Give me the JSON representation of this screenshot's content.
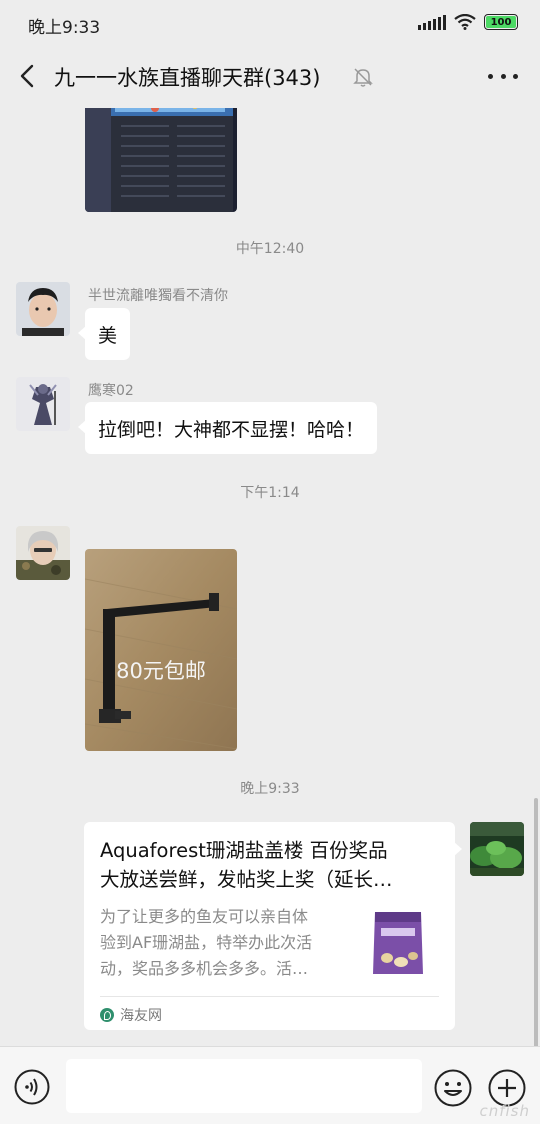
{
  "status_bar": {
    "time": "晚上9:33",
    "battery": "100"
  },
  "header": {
    "title": "九一一水族直播聊天群(343)"
  },
  "messages": {
    "timestamp_1": "中午12:40",
    "msg1": {
      "sender": "半世流離唯獨看不清你",
      "text": "美"
    },
    "msg2": {
      "sender": "鹰寒02",
      "text": "拉倒吧！大神都不显摆！哈哈！"
    },
    "timestamp_2": "下午1:14",
    "msg3": {
      "image_caption": "80元包邮"
    },
    "timestamp_3": "晚上9:33",
    "card": {
      "title_line1": "Aquaforest珊湖盐盖楼 百份奖品",
      "title_line2": "大放送尝鲜，发帖奖上奖（延长…",
      "desc_line1": "为了让更多的鱼友可以亲自体",
      "desc_line2": "验到AF珊湖盐，特举办此次活",
      "desc_line3": "动，奖品多多机会多多。活…",
      "source": "海友网"
    }
  },
  "input_bar": {
    "placeholder": ""
  },
  "watermark": "cnfish"
}
